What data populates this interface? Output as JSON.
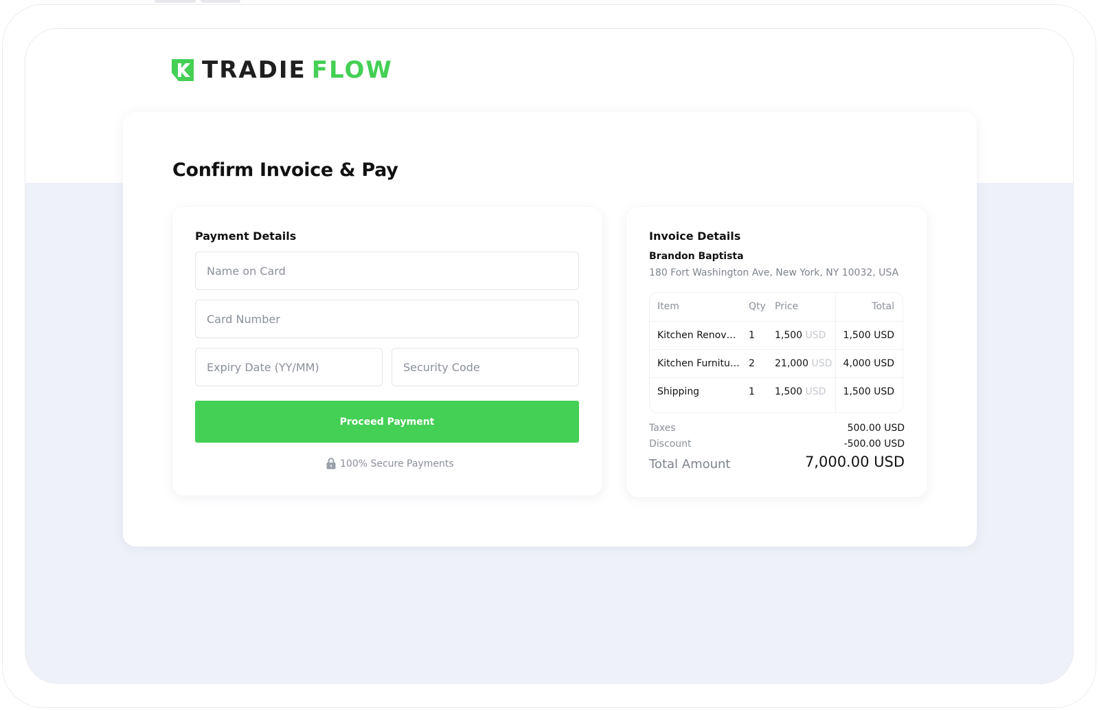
{
  "brand": {
    "name_part1": "TRADIE",
    "name_part2": "FLOW",
    "primary_color": "#44cf55",
    "dark_color": "#1f1f1f"
  },
  "page": {
    "title": "Confirm Invoice & Pay"
  },
  "payment": {
    "title": "Payment Details",
    "name_placeholder": "Name on Card",
    "card_placeholder": "Card Number",
    "expiry_placeholder": "Expiry Date (YY/MM)",
    "security_placeholder": "Security Code",
    "proceed_label": "Proceed Payment",
    "secure_note": "100% Secure Payments",
    "secure_icon": "lock-icon"
  },
  "invoice": {
    "title": "Invoice Details",
    "client_name": "Brandon Baptista",
    "client_address": "180 Fort Washington Ave, New York, NY 10032, USA",
    "columns": {
      "item": "Item",
      "qty": "Qty",
      "price": "Price",
      "total": "Total"
    },
    "items": [
      {
        "item": "Kitchen Renovat...",
        "qty": "1",
        "price": "1,500",
        "price_unit": "USD",
        "total": "1,500 USD"
      },
      {
        "item": "Kitchen Furnitur...",
        "qty": "2",
        "price": "21,000",
        "price_unit": "USD",
        "total": "4,000 USD"
      },
      {
        "item": "Shipping",
        "qty": "1",
        "price": "1,500",
        "price_unit": "USD",
        "total": "1,500 USD"
      }
    ],
    "taxes_label": "Taxes",
    "taxes_value": "500.00 USD",
    "discount_label": "Discount",
    "discount_value": "-500.00 USD",
    "total_label": "Total Amount",
    "total_value": "7,000.00 USD"
  }
}
